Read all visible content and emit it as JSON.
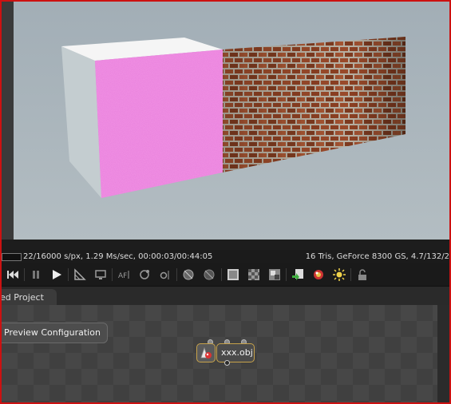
{
  "window": {
    "border_color": "#cc1111"
  },
  "viewport": {
    "background": "#a8b4bb",
    "scene": [
      "white-cube-with-pink-face",
      "brick-wall"
    ]
  },
  "status": {
    "left": "22/16000 s/px, 1.29 Ms/sec, 00:00:03/00:44:05",
    "right": "16 Tris, GeForce 8300 GS, 4.7/132/2"
  },
  "toolbar": {
    "icons": [
      "rewind-icon",
      "pause-icon",
      "play-icon",
      "region-render-icon",
      "monitor-icon",
      "af-icon",
      "camera-orbit-icon",
      "focus-icon",
      "sphere-icon",
      "sphere-disabled-icon",
      "resolution-icon",
      "checker-icon",
      "layers-icon",
      "export-icon",
      "material-icon",
      "light-icon",
      "lock-icon"
    ]
  },
  "tabs": {
    "project_label": "ed Project"
  },
  "graph": {
    "preview_button_label": "Preview Configuration",
    "node_label": "xxx.obj",
    "node_border_color": "#c7a24a"
  }
}
